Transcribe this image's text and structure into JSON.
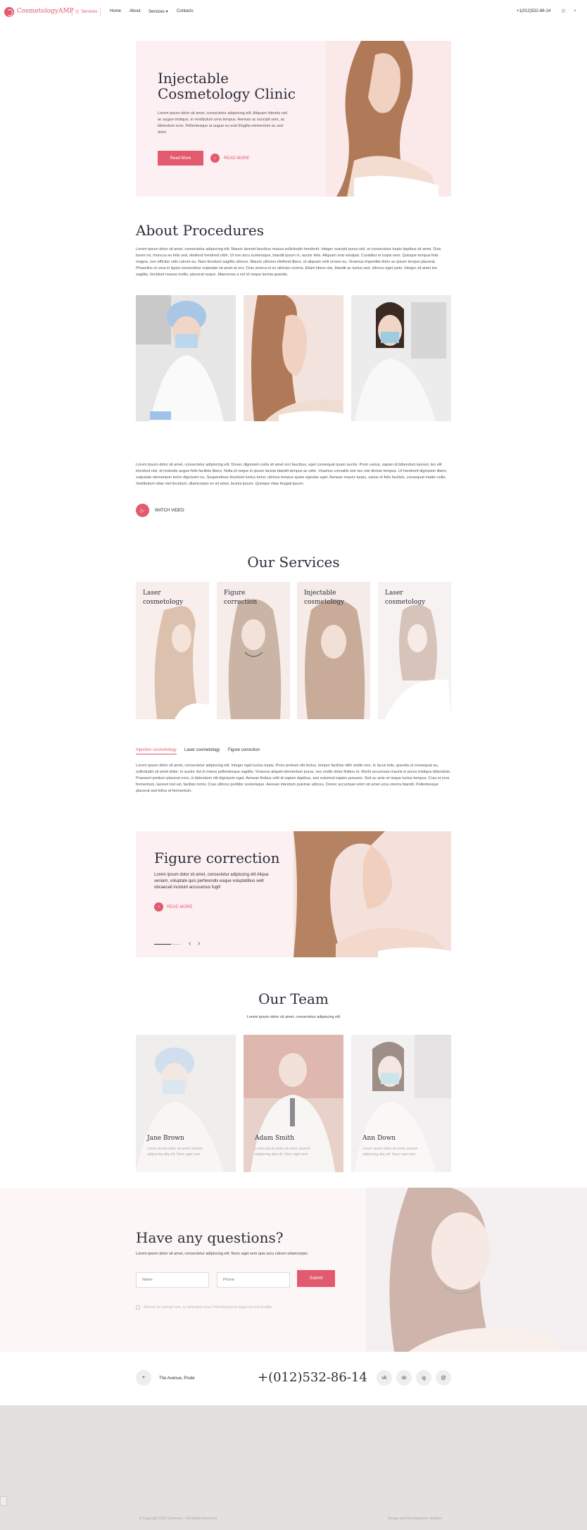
{
  "header": {
    "logo": "CosmetologyAMP",
    "services_button": "Services",
    "nav": [
      "Home",
      "About",
      "Services ▾",
      "Contacts"
    ],
    "phone": "+1(012)532-86-14"
  },
  "hero": {
    "title_line1": "Injectable",
    "title_line2": "Cosmetology Clinic",
    "text": "Lorem ipsum dolor sit amet, consectetur adipiscing elit. Aliquam lobortis nisl ac augue tristique, in vestibulum urna tempus. Aenean ac suscipit sem, ac bibendum eros. Pellentesque at augue eu erat fringilla elementum ac sed dolor.",
    "button": "Read More",
    "link": "READ MORE"
  },
  "about": {
    "title": "About Procedures",
    "text": "Lorem ipsum dolor sit amet, consectetur adipiscing elit. Mauris laoreet faucibus massa sollicitudin hendrerit. Integer suscipit purus nisl, et consectetur turpis dapibus sit amet. Duis lorem mi, rhoncus eu felis sed, eleifend hendrerit nibh. Ut non arcu scelerisque, blandit ipsum in, auctor felis. Aliquam erat volutpat. Curabitur et turpis sem. Quisque tempus felis magna, non efficitur odio rutrum eu. Nam tincidunt sagittis ultrices. Mauris ultricies eleifend libero, id aliquam velit ornare eu. Vivamus imperdiet dolor ac ipsum tempor placerat. Phasellus ut urna in ligula consectetur vulputate sit amet at orci. Duis viverra et ex ultricies viverra. Etiam libero nisi, blandit ac luctus sed, ultrices eget justo. Integer sit amet leo sagittis, tincidunt massa mollis, placerat neque. Maecenas a est id neque lacinia gravida.",
    "text2": "Lorem ipsum dolor sit amet, consectetur adipiscing elit. Donec dignissim nulla sit amet orci faucibus, eget consequat quam auctor. Proin varius, sapien id bibendum laoreet, leo elit tincidunt nisl, id molestie augue felis facilisis libero. Nulla id neque in ipsum lacinia blandit tempus ac odio. Vivamus convallis nisl nec nisi dictum tempus. Ut hendrerit dignissim libero, vulputate elementum tortor dignissim eu. Suspendisse tincidunt luctus tortor, ultrices tempus quam egestas eget. Aenean mauris turpis, varius et felis facilisis, consequat mattis nulla. Vestibulum vitae nisl tincidunt, ullamcorper ex sit amet, lacinia ipsum. Quisque vitae feugiat ipsum.",
    "video": "WATCH VIDEO"
  },
  "services": {
    "title": "Our Services",
    "cards": [
      {
        "l1": "Laser",
        "l2": "cosmetology"
      },
      {
        "l1": "Figure",
        "l2": "correction"
      },
      {
        "l1": "Injectable",
        "l2": "cosmetology"
      },
      {
        "l1": "Laser",
        "l2": "cosmetology"
      }
    ],
    "tabs": [
      "Injection cosmetology",
      "Laser cosmetology",
      "Figure correction"
    ],
    "tab_text": "Lorem ipsum dolor sit amet, consectetur adipiscing elit. Integer eget luctus turpis. Proin pretium elit lectus, tempor facilisis nibh mollis non. In lacus felis, gravida ut consequat eu, sollicitudin sit amet dolor. In auctor dui in metus pellentesque sagittis. Vivamus aliquet elementum purus, nec mollis dolor finibus et. Morbi accumsan mauris in purus tristique bibendum. Praesent pretium placerat eros, in bibendum elit dignissim eget. Aenean finibus velit id sapien dapibus, sed euismod sapien posuere. Sed ac ante et neque luctus tempus. Cras et eros fermentum, laoreet nisl vel, facilisis tortor. Cras ultrices porttitor scelerisque. Aenean interdum pulvinar ultrices. Donec accumsan enim sit amet urna viverra blandit. Pellentesque placerat sed tellus et fermentum."
  },
  "promo": {
    "title": "Figure correction",
    "text": "Lorem ipsum dolor sit amet, consectetur adipiscing elit Aliqua veniam, voluptate quis perferendis eaque voluptatibus velit obcaecati incidunt accusamus fugit!",
    "link": "READ MORE"
  },
  "team": {
    "title": "Our Team",
    "subtitle": "Lorem ipsum dolor sit amet, consectetur adipiscing elit",
    "members": [
      {
        "name": "Jane Brown",
        "text": "Lorem ipsum dolor sit amet, laoreet adipiscing aliq elit. Nunc eget sem"
      },
      {
        "name": "Adam Smith",
        "text": "Lorem ipsum dolor sit amet, laoreet adipiscing aliq elit. Nunc eget sem"
      },
      {
        "name": "Ann Down",
        "text": "Lorem ipsum dolor sit amet, laoreet adipiscing aliq elit. Nunc eget sem"
      }
    ]
  },
  "contact": {
    "title": "Have any questions?",
    "subtitle": "Lorem ipsum dolor sit amet, consectetur adipiscing elit. Nunc eget sem quis arcu rutrum ullamcorper.",
    "name_placeholder": "Name",
    "phone_placeholder": "Phone",
    "submit": "Submit",
    "agree": "Aenean ac suscipit sem, ac bibendum eros. Pellentesque at augue eu erat fringilla"
  },
  "footer": {
    "address": "The Avenue, Poole",
    "phone": "+(012)532-86-14",
    "social": [
      "vk",
      "sk",
      "ig",
      "@"
    ],
    "copyright": "© Copyright 2022 Cosmetic – All Rights Reserved",
    "credit": "Design and Development: Webline"
  },
  "colors": {
    "accent": "#e25a6e",
    "pink_bg": "#fdf0f2",
    "footer_bg": "#e2e1df"
  }
}
